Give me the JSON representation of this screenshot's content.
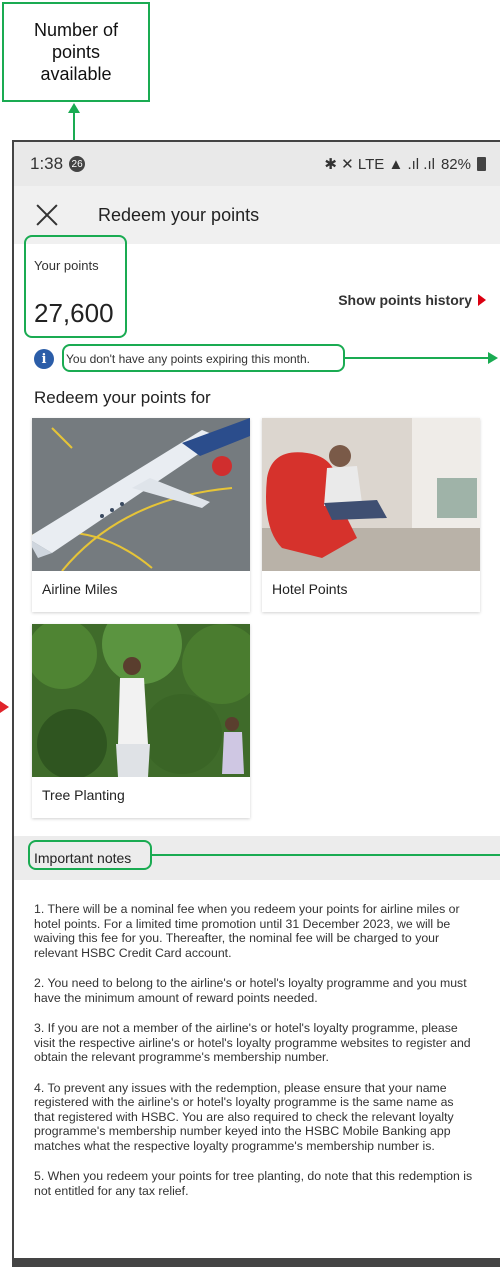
{
  "annotation": {
    "callout_text": "Number of points available",
    "accent_color": "#1aab52",
    "marker_color": "#e0242b"
  },
  "statusbar": {
    "time": "1:38",
    "notification_badge": "26",
    "indicators": "✱ ✕ LTE ▲ .ıl .ıl",
    "battery": "82%"
  },
  "appbar": {
    "title": "Redeem your points",
    "close_icon": "close-icon"
  },
  "points": {
    "label": "Your points",
    "value": "27,600",
    "history_link": "Show points history"
  },
  "info": {
    "icon": "info-icon",
    "text": "You don't have any points expiring this month."
  },
  "redeem": {
    "heading": "Redeem your points for",
    "options": [
      {
        "label": "Airline Miles"
      },
      {
        "label": "Hotel Points"
      },
      {
        "label": "Tree Planting"
      }
    ]
  },
  "notes": {
    "title": "Important notes",
    "items": [
      "1. There will be a nominal fee when you redeem your points for airline miles or hotel points. For a limited time promotion until 31 December 2023, we will be waiving this fee for you. Thereafter, the nominal fee will be charged to your relevant HSBC Credit Card account.",
      "2. You need to belong to the airline's or hotel's loyalty programme and you must have the minimum amount of reward points needed.",
      "3. If you are not a member of the airline's or hotel's loyalty programme, please visit the respective airline's or hotel's loyalty programme websites to register and obtain the relevant programme's membership number.",
      "4. To prevent any issues with the redemption, please ensure that your name registered with the airline's or hotel's loyalty programme is the same name as that registered with HSBC. You are also required to check the relevant loyalty programme's membership number keyed into the HSBC Mobile Banking app matches what the respective loyalty programme's membership number is.",
      "5. When you redeem your points for tree planting, do note that this redemption is not entitled for any tax relief."
    ]
  },
  "colors": {
    "brand_red": "#db0011",
    "info_blue": "#2b5da8"
  }
}
